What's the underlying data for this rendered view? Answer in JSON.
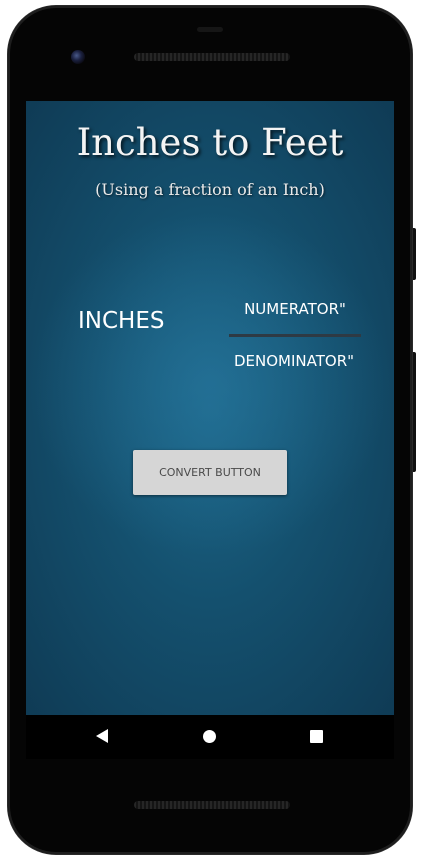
{
  "app": {
    "title": "Inches to Feet",
    "subtitle": "(Using a fraction of an Inch)"
  },
  "form": {
    "inches_label": "INCHES",
    "numerator_placeholder": "NUMERATOR\"",
    "denominator_placeholder": "DENOMINATOR\"",
    "convert_button_label": "CONVERT BUTTON"
  },
  "nav": {
    "back_icon": "back-triangle-icon",
    "home_icon": "home-circle-icon",
    "recents_icon": "recents-square-icon"
  },
  "colors": {
    "screen_background": "#14506e",
    "button_background": "#d6d6d6",
    "text": "#ffffff"
  }
}
